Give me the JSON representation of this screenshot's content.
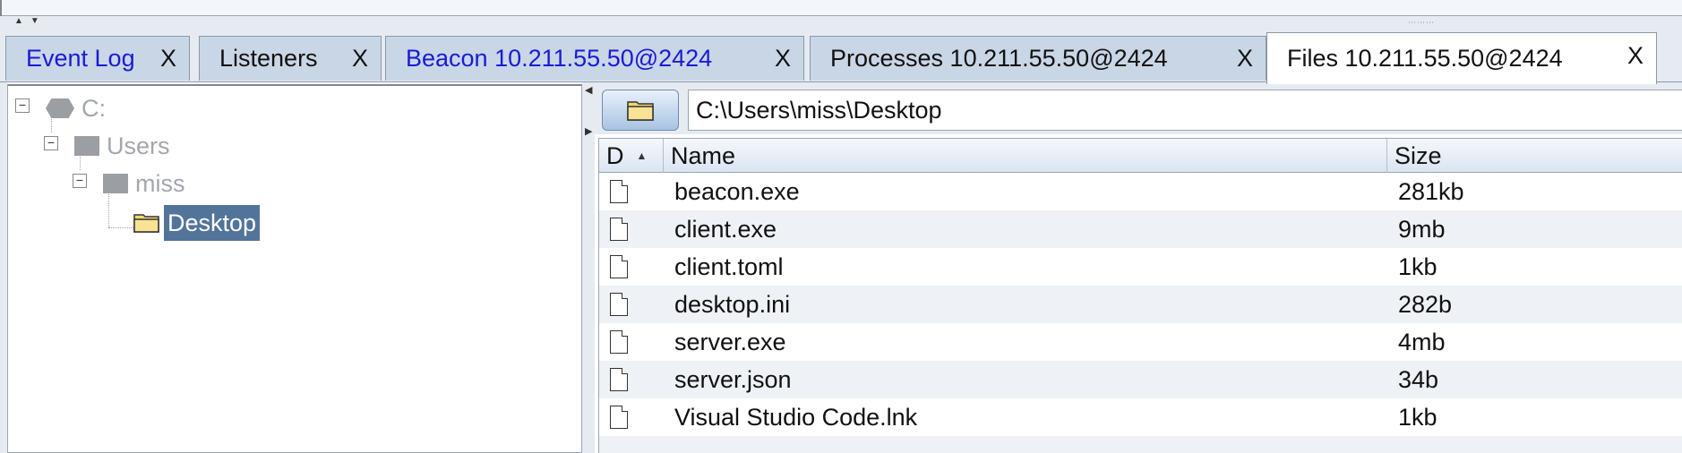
{
  "tabs": [
    {
      "label": "Event Log",
      "close": "X",
      "style": "blue"
    },
    {
      "label": "Listeners",
      "close": "X",
      "style": "normal"
    },
    {
      "label": "Beacon 10.211.55.50@2424",
      "close": "X",
      "style": "blue"
    },
    {
      "label": "Processes 10.211.55.50@2424",
      "close": "X",
      "style": "normal"
    },
    {
      "label": "Files 10.211.55.50@2424",
      "close": "X",
      "style": "active"
    }
  ],
  "tree": {
    "drive": "C:",
    "users": "Users",
    "user": "miss",
    "selected": "Desktop"
  },
  "path": {
    "value": "C:\\Users\\miss\\Desktop"
  },
  "table": {
    "columns": [
      "D",
      "Name",
      "Size"
    ],
    "rows": [
      {
        "name": "beacon.exe",
        "size": "281kb"
      },
      {
        "name": "client.exe",
        "size": "9mb"
      },
      {
        "name": "client.toml",
        "size": "1kb"
      },
      {
        "name": "desktop.ini",
        "size": "282b"
      },
      {
        "name": "server.exe",
        "size": "4mb"
      },
      {
        "name": "server.json",
        "size": "34b"
      },
      {
        "name": "Visual Studio Code.lnk",
        "size": "1kb"
      }
    ]
  },
  "colors": {
    "selection": "#52749a",
    "tab_blue_text": "#1a1ad6",
    "tab_bg": "#c9d6e6"
  }
}
